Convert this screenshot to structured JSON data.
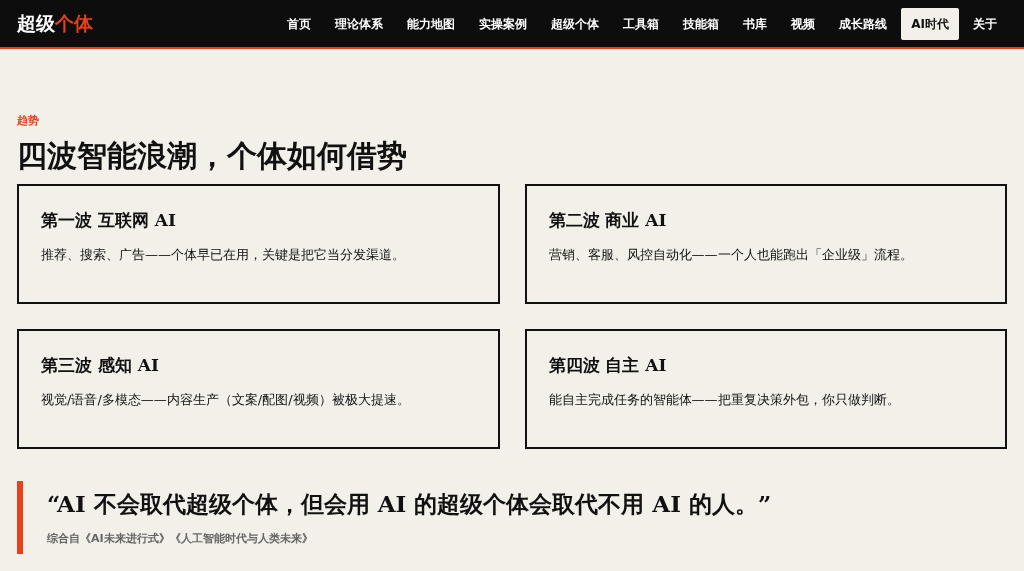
{
  "logo": {
    "main": "超级",
    "accent": "个体"
  },
  "nav": [
    {
      "label": "首页",
      "selected": false
    },
    {
      "label": "理论体系",
      "selected": false
    },
    {
      "label": "能力地图",
      "selected": false
    },
    {
      "label": "实操案例",
      "selected": false
    },
    {
      "label": "超级个体",
      "selected": false
    },
    {
      "label": "工具箱",
      "selected": false
    },
    {
      "label": "技能箱",
      "selected": false
    },
    {
      "label": "书库",
      "selected": false
    },
    {
      "label": "视频",
      "selected": false
    },
    {
      "label": "成长路线",
      "selected": false
    },
    {
      "label": "AI时代",
      "selected": true
    },
    {
      "label": "关于",
      "selected": false
    }
  ],
  "section": {
    "eyebrow": "趋势",
    "title": "四波智能浪潮，个体如何借势"
  },
  "cards": [
    {
      "title": "第一波 互联网 AI",
      "text": "推荐、搜索、广告——个体早已在用，关键是把它当分发渠道。"
    },
    {
      "title": "第二波 商业 AI",
      "text": "营销、客服、风控自动化——一个人也能跑出「企业级」流程。"
    },
    {
      "title": "第三波 感知 AI",
      "text": "视觉/语音/多模态——内容生产（文案/配图/视频）被极大提速。"
    },
    {
      "title": "第四波 自主 AI",
      "text": "能自主完成任务的智能体——把重复决策外包，你只做判断。"
    }
  ],
  "quote": {
    "text": "“AI 不会取代超级个体，但会用 AI 的超级个体会取代不用 AI 的人。”",
    "source": "综合自《AI未来进行式》《人工智能时代与人类未来》"
  }
}
